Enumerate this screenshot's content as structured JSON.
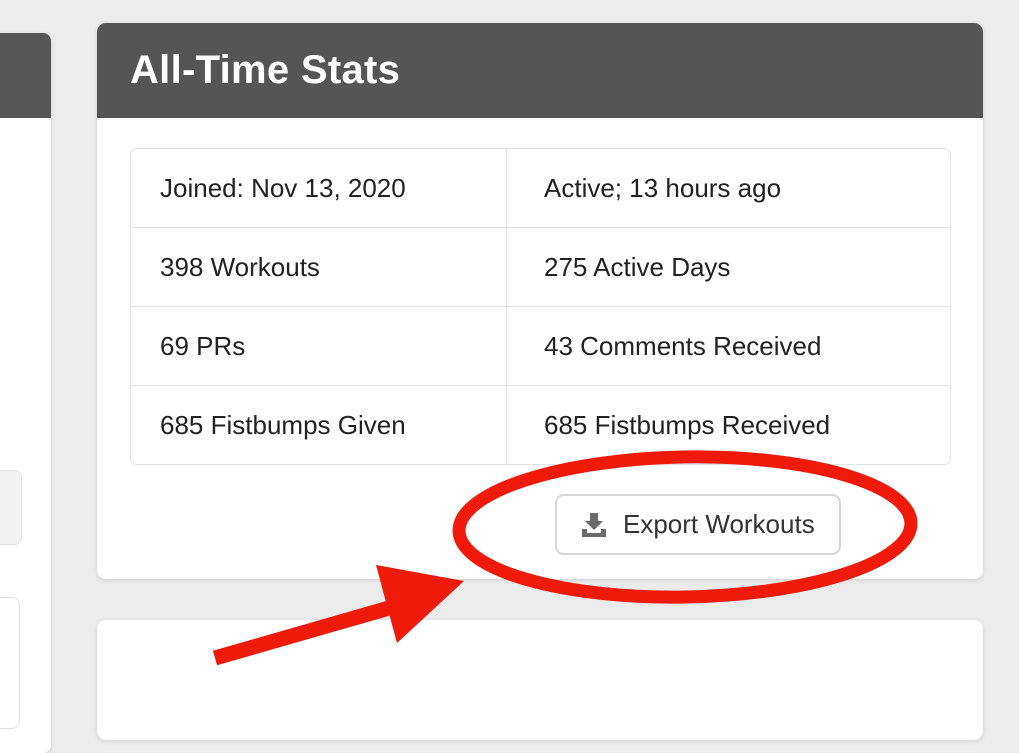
{
  "card": {
    "title": "All-Time Stats",
    "rows": [
      {
        "left": "Joined: Nov 13, 2020",
        "right": "Active; 13 hours ago"
      },
      {
        "left": "398 Workouts",
        "right": "275 Active Days"
      },
      {
        "left": "69 PRs",
        "right": "43 Comments Received"
      },
      {
        "left": "685 Fistbumps Given",
        "right": "685 Fistbumps Received"
      }
    ],
    "export_button": {
      "label": "Export Workouts",
      "icon": "download-icon"
    }
  },
  "colors": {
    "header_bg": "#555555",
    "page_bg": "#ececec",
    "annotation_red": "#f01a0a"
  }
}
